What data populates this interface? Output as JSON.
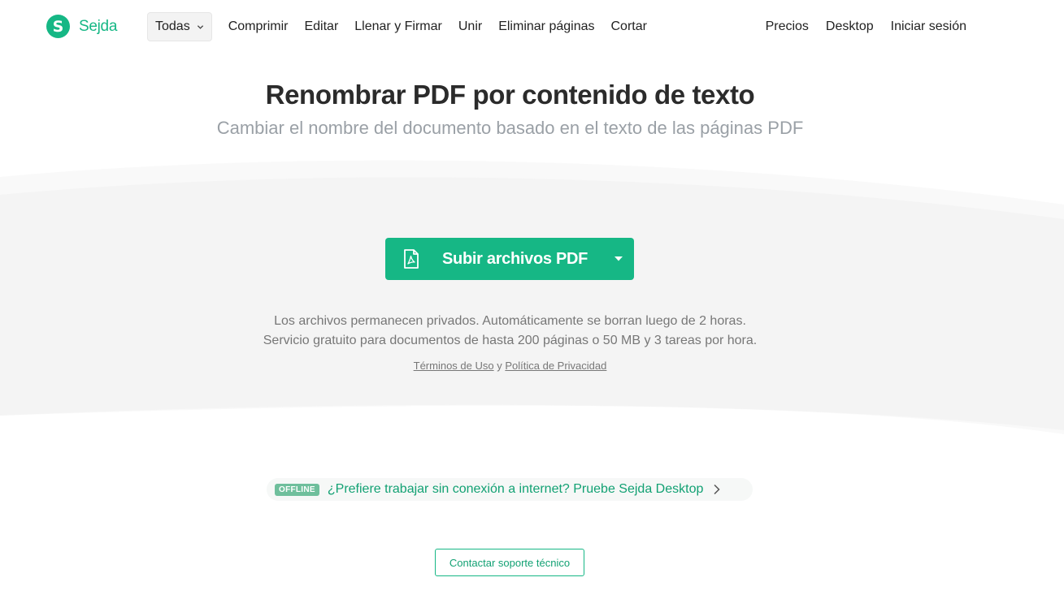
{
  "brand": {
    "name": "Sejda",
    "mark": "S"
  },
  "nav": {
    "dropdown_label": "Todas",
    "items": [
      "Comprimir",
      "Editar",
      "Llenar y Firmar",
      "Unir",
      "Eliminar páginas",
      "Cortar"
    ],
    "right_items": [
      "Precios",
      "Desktop",
      "Iniciar sesión"
    ]
  },
  "hero": {
    "title": "Renombrar PDF por contenido de texto",
    "subtitle": "Cambiar el nombre del documento basado en el texto de las páginas PDF"
  },
  "upload": {
    "label": "Subir archivos PDF",
    "privacy_note": "Los archivos permanecen privados. Automáticamente se borran luego de 2 horas.",
    "limits_note": "Servicio gratuito para documentos de hasta 200 páginas o 50 MB y 3 tareas por hora.",
    "terms_link": "Términos de Uso",
    "conjunction": "y",
    "privacy_link": "Política de Privacidad"
  },
  "offline": {
    "badge": "OFFLINE",
    "text": "¿Prefiere trabajar sin conexión a internet? Pruebe Sejda Desktop"
  },
  "support": {
    "label": "Contactar soporte técnico"
  },
  "colors": {
    "accent": "#16b785",
    "accent_text": "#12a173",
    "band": "#f5f5f5"
  }
}
